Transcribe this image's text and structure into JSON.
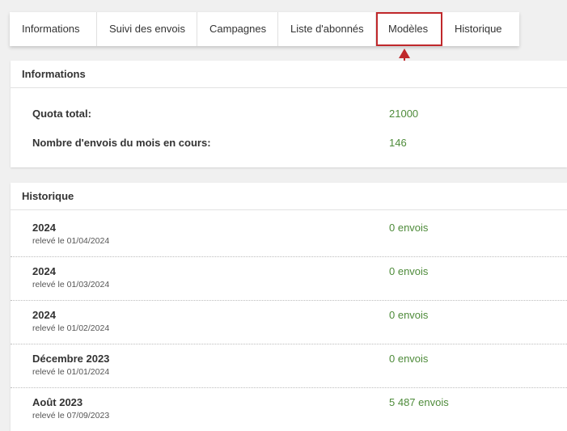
{
  "tabs": [
    {
      "label": "Informations"
    },
    {
      "label": "Suivi des envois"
    },
    {
      "label": "Campagnes"
    },
    {
      "label": "Liste d'abonnés"
    },
    {
      "label": "Modèles"
    },
    {
      "label": "Historique"
    }
  ],
  "colors": {
    "accent": "#c0282b",
    "value_green": "#4e8b3a"
  },
  "informations": {
    "title": "Informations",
    "quota_label": "Quota total:",
    "quota_value": "21000",
    "monthly_label": "Nombre d'envois du mois en cours:",
    "monthly_value": "146"
  },
  "historique": {
    "title": "Historique",
    "rows": [
      {
        "period": "2024",
        "date": "relevé le 01/04/2024",
        "count": "0 envois"
      },
      {
        "period": "2024",
        "date": "relevé le 01/03/2024",
        "count": "0 envois"
      },
      {
        "period": "2024",
        "date": "relevé le 01/02/2024",
        "count": "0 envois"
      },
      {
        "period": "Décembre 2023",
        "date": "relevé le 01/01/2024",
        "count": "0 envois"
      },
      {
        "period": "Août 2023",
        "date": "relevé le 07/09/2023",
        "count": "5 487 envois"
      }
    ]
  }
}
